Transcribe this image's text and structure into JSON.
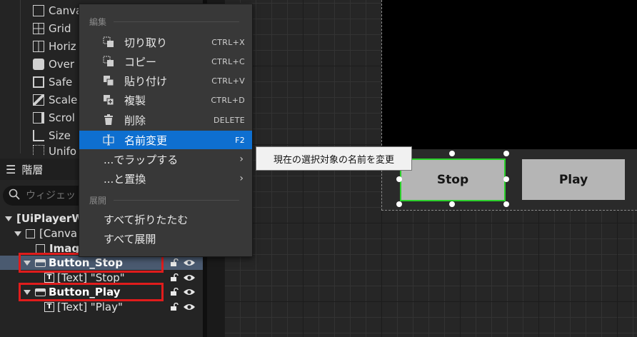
{
  "palette": {
    "items": [
      {
        "label": "Canva",
        "icon": "canvas-panel-icon"
      },
      {
        "label": "Grid",
        "icon": "grid-panel-icon"
      },
      {
        "label": "Horiz",
        "icon": "horizontal-box-icon"
      },
      {
        "label": "Over",
        "icon": "overlay-icon"
      },
      {
        "label": "Safe",
        "icon": "safe-zone-icon"
      },
      {
        "label": "Scale",
        "icon": "scale-box-icon"
      },
      {
        "label": "Scrol",
        "icon": "scroll-box-icon"
      },
      {
        "label": "Size",
        "icon": "size-box-icon"
      },
      {
        "label": "Unifo",
        "icon": "uniform-grid-icon"
      }
    ]
  },
  "hierarchy": {
    "title": "階層",
    "search_placeholder": "ウィジェット",
    "rows": [
      {
        "label": "[UiPlayerW",
        "icon": "none"
      },
      {
        "label": "[Canva",
        "icon": "canvas-panel-icon"
      },
      {
        "label": "Imag",
        "icon": "image-icon"
      },
      {
        "label": "Button_Stop",
        "icon": "button-icon",
        "selected": true
      },
      {
        "label": "[Text] \"Stop\"",
        "icon": "text-icon"
      },
      {
        "label": "Button_Play",
        "icon": "button-icon"
      },
      {
        "label": "[Text] \"Play\"",
        "icon": "text-icon"
      }
    ]
  },
  "context_menu": {
    "section_edit": "編集",
    "section_expand": "展開",
    "items": [
      {
        "label": "切り取り",
        "shortcut": "CTRL+X",
        "icon": "cut-icon"
      },
      {
        "label": "コピー",
        "shortcut": "CTRL+C",
        "icon": "copy-icon"
      },
      {
        "label": "貼り付け",
        "shortcut": "CTRL+V",
        "icon": "paste-icon"
      },
      {
        "label": "複製",
        "shortcut": "CTRL+D",
        "icon": "duplicate-icon"
      },
      {
        "label": "削除",
        "shortcut": "DELETE",
        "icon": "delete-icon"
      },
      {
        "label": "名前変更",
        "shortcut": "F2",
        "icon": "rename-icon",
        "highlighted": true
      },
      {
        "label": "...でラップする",
        "arrow": "›"
      },
      {
        "label": "...と置換",
        "arrow": "›"
      },
      {
        "label": "すべて折りたたむ"
      },
      {
        "label": "すべて展開"
      }
    ]
  },
  "tooltip": {
    "text": "現在の選択対象の名前を変更"
  },
  "canvas": {
    "stop_label": "Stop",
    "play_label": "Play"
  },
  "colors": {
    "highlight": "#0e6fd0",
    "selection_row": "#4a5a70",
    "annotation_red": "#e01c1c",
    "selected_outline": "#2ad02a"
  }
}
